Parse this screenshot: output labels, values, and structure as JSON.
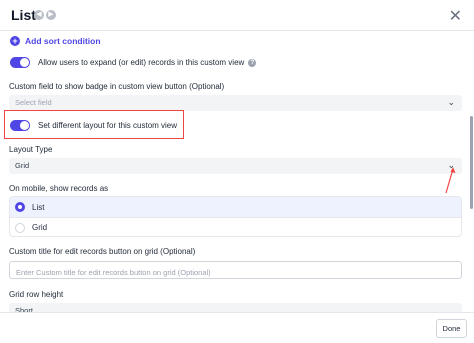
{
  "header": {
    "title": "List",
    "nav_icons": [
      "left-chevron-circle-icon",
      "right-chevron-circle-icon"
    ],
    "close_icon": "close-icon"
  },
  "sort": {
    "add_label": "Add sort condition",
    "icon": "plus-circle-icon"
  },
  "expand_toggle": {
    "label": "Allow users to expand (or edit) records in this custom view",
    "on": true
  },
  "badge_field": {
    "label": "Custom field to show badge in custom view button (Optional)",
    "placeholder": "Select field"
  },
  "layout_toggle": {
    "label": "Set different layout for this custom view",
    "on": true
  },
  "layout_type": {
    "label": "Layout Type",
    "value": "Grid"
  },
  "mobile": {
    "label": "On mobile, show records as",
    "options": [
      {
        "label": "List",
        "selected": true
      },
      {
        "label": "Grid",
        "selected": false
      }
    ]
  },
  "edit_title": {
    "label": "Custom title for edit records button on grid (Optional)",
    "placeholder": "Enter Custom title for edit records button on grid (Optional)"
  },
  "grid_row_height": {
    "label": "Grid row height",
    "value": "Short"
  },
  "footer": {
    "done_label": "Done"
  },
  "colors": {
    "accent": "#4f46e5",
    "highlight": "#ef4444",
    "field_bg": "#f3f4f6"
  }
}
